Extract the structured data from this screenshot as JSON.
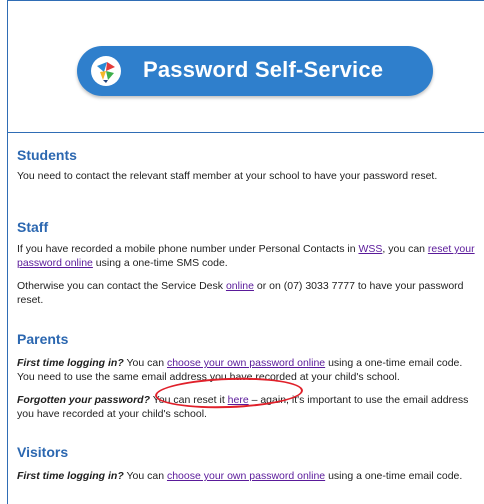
{
  "banner": {
    "title": "Password Self-Service",
    "colors": {
      "background": "#2f7fcc",
      "text": "#ffffff"
    },
    "icon": "logo-icon"
  },
  "sections": {
    "students": {
      "heading": "Students",
      "text": "You need to contact the relevant staff member at your school to have your password reset."
    },
    "staff": {
      "heading": "Staff",
      "p1_before": "If you have recorded a mobile phone number under Personal Contacts in ",
      "p1_link1": "WSS",
      "p1_mid": ", you can ",
      "p1_link2": "reset your password online",
      "p1_after": " using a one-time SMS code.",
      "p2_before": "Otherwise you can contact the Service Desk ",
      "p2_link": "online",
      "p2_after": " or on (07) 3033 7777 to have your password reset."
    },
    "parents": {
      "heading": "Parents",
      "p1_bold": "First time logging in?",
      "p1_before": " You can ",
      "p1_link": "choose your own password online",
      "p1_after": " using a one-time email code. You need to use the same email address you have recorded at your child's school.",
      "p2_bold": "Forgotten your password?",
      "p2_before": " You can reset it ",
      "p2_link": "here",
      "p2_after": " – again, it's important to use the email address you have recorded at your child's school."
    },
    "visitors": {
      "heading": "Visitors",
      "p1_bold": "First time logging in?",
      "p1_before": " You can ",
      "p1_link": "choose your own password online",
      "p1_after": " using a one-time email code."
    }
  },
  "colors": {
    "heading": "#2b67b0",
    "link": "#5a1a9a",
    "highlight": "#e0202a",
    "border": "#2f6db5"
  }
}
